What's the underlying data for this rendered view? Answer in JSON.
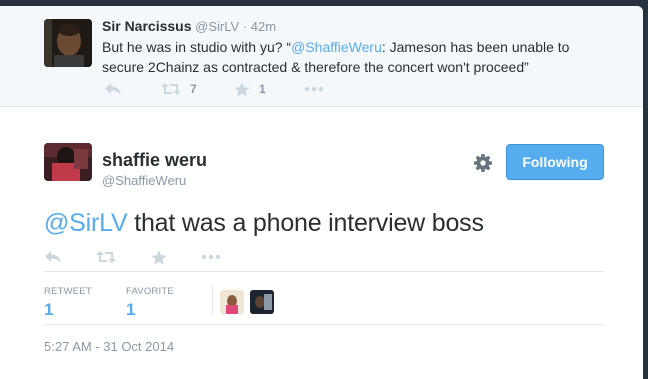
{
  "parent_tweet": {
    "author_name": "Sir Narcissus",
    "author_handle": "@SirLV",
    "separator": "·",
    "time": "42m",
    "text_before": "But he was in studio with yu? “",
    "mention": "@ShaffieWeru",
    "text_after": ": Jameson has been unable to secure 2Chainz as contracted & therefore the  concert won't proceed”",
    "retweet_count": "7",
    "favorite_count": "1"
  },
  "main_tweet": {
    "author_name": "shaffie weru",
    "author_handle": "@ShaffieWeru",
    "follow_label": "Following",
    "mention": "@SirLV",
    "text": " that was a phone interview boss",
    "stats": {
      "retweet_label": "RETWEET",
      "retweet_value": "1",
      "favorite_label": "FAVORITE",
      "favorite_value": "1"
    },
    "timestamp": "5:27 AM - 31 Oct 2014"
  },
  "icons": {
    "reply": "reply-icon",
    "retweet": "retweet-icon",
    "favorite": "star-icon",
    "more": "more-icon",
    "settings": "gear-icon"
  },
  "colors": {
    "accent": "#55acee",
    "muted": "#8899a6",
    "text": "#292f33",
    "parent_bg": "#f5f8fa",
    "backdrop": "#26323d"
  }
}
